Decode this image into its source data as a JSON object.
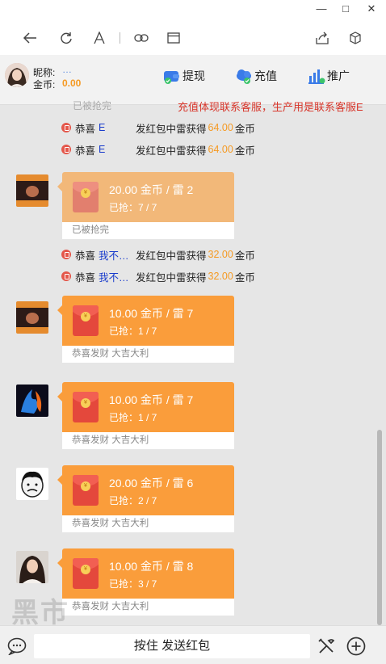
{
  "window": {
    "minimize_glyph": "—",
    "maximize_glyph": "□",
    "close_glyph": "✕"
  },
  "header": {
    "nickname_label": "昵称:",
    "nickname_value": "…",
    "coins_label": "金币:",
    "coins_value": "0.00",
    "actions": [
      {
        "label": "提现",
        "icon": "wallet-icon"
      },
      {
        "label": "充值",
        "icon": "recharge-cloud-icon"
      },
      {
        "label": "推广",
        "icon": "bar-chart-icon"
      }
    ]
  },
  "chat": {
    "top_partial_text": "已被抢完",
    "notice": "充值体现联系客服，生产用是联系客服E",
    "system_messages": [
      {
        "prefix": "恭喜",
        "name": "E",
        "text": "发红包中雷获得",
        "amount": "64.00",
        "unit": "金币"
      },
      {
        "prefix": "恭喜",
        "name": "E",
        "text": "发红包中雷获得",
        "amount": "64.00",
        "unit": "金币"
      },
      {
        "prefix": "恭喜",
        "name": "我不打…",
        "text": "发红包中雷获得",
        "amount": "32.00",
        "unit": "金币"
      },
      {
        "prefix": "恭喜",
        "name": "我不打…",
        "text": "发红包中雷获得",
        "amount": "32.00",
        "unit": "金币"
      }
    ],
    "packets": [
      {
        "title": "20.00 金币 / 雷 2",
        "grabbed": "已抢：7 / 7",
        "footer": "已被抢完",
        "done": true
      },
      {
        "title": "10.00 金币 / 雷 7",
        "grabbed": "已抢：1 / 7",
        "footer": "恭喜发财 大吉大利",
        "done": false
      },
      {
        "title": "10.00 金币 / 雷 7",
        "grabbed": "已抢：1 / 7",
        "footer": "恭喜发财 大吉大利",
        "done": false
      },
      {
        "title": "20.00 金币 / 雷 6",
        "grabbed": "已抢：2 / 7",
        "footer": "恭喜发财 大吉大利",
        "done": false
      },
      {
        "title": "10.00 金币 / 雷 8",
        "grabbed": "已抢：3 / 7",
        "footer": "恭喜发财 大吉大利",
        "done": false
      }
    ]
  },
  "bottom": {
    "send_button": "按住 发送红包"
  },
  "colors": {
    "packet": "#fa9d3b",
    "packet_done": "#f2b879",
    "amount": "#f59a23",
    "name": "#1a3ccc",
    "notice": "#d8362b"
  }
}
